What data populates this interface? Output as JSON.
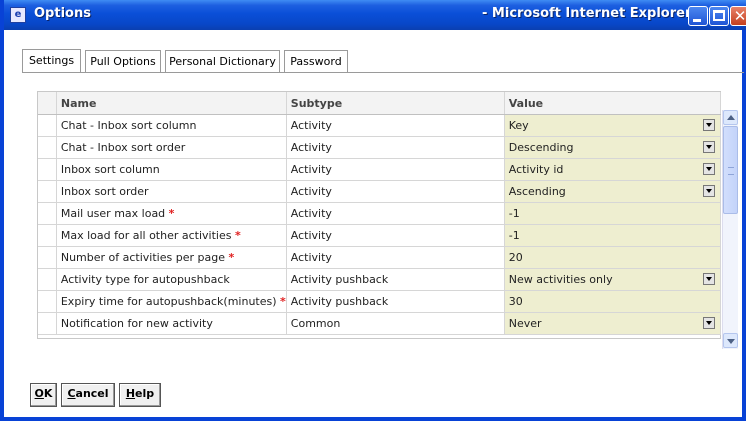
{
  "window": {
    "title_left": "Options",
    "title_right": "- Microsoft Internet Explorer"
  },
  "tabs": [
    {
      "label": "Settings"
    },
    {
      "label": "Pull Options"
    },
    {
      "label": "Personal Dictionary"
    },
    {
      "label": "Password"
    }
  ],
  "table": {
    "headers": {
      "name": "Name",
      "subtype": "Subtype",
      "value": "Value"
    },
    "rows": [
      {
        "name": "Chat - Inbox sort column",
        "req": "",
        "subtype": "Activity",
        "value": "Key"
      },
      {
        "name": "Chat - Inbox sort order",
        "req": "",
        "subtype": "Activity",
        "value": "Descending"
      },
      {
        "name": "Inbox sort column",
        "req": "",
        "subtype": "Activity",
        "value": "Activity id"
      },
      {
        "name": "Inbox sort order",
        "req": "",
        "subtype": "Activity",
        "value": "Ascending"
      },
      {
        "name": "Mail user max load",
        "req": "*",
        "subtype": "Activity",
        "value": "-1"
      },
      {
        "name": "Max load for all other activities",
        "req": "*",
        "subtype": "Activity",
        "value": "-1"
      },
      {
        "name": "Number of activities per page",
        "req": "*",
        "subtype": "Activity",
        "value": "20"
      },
      {
        "name": "Activity type for autopushback",
        "req": "",
        "subtype": "Activity pushback",
        "value": "New activities only"
      },
      {
        "name": "Expiry time for autopushback(minutes)",
        "req": "*",
        "subtype": "Activity pushback",
        "value": "30"
      },
      {
        "name": "Notification for new activity",
        "req": "",
        "subtype": "Common",
        "value": "Never"
      }
    ]
  },
  "buttons": {
    "ok_first": "O",
    "ok_rest": "K",
    "cancel_first": "C",
    "cancel_rest": "ancel",
    "help_first": "H",
    "help_rest": "elp"
  },
  "colors": {
    "titlebar": "#0a4fd8",
    "value_cell": "#eeeed0",
    "required_marker": "#e02020"
  }
}
